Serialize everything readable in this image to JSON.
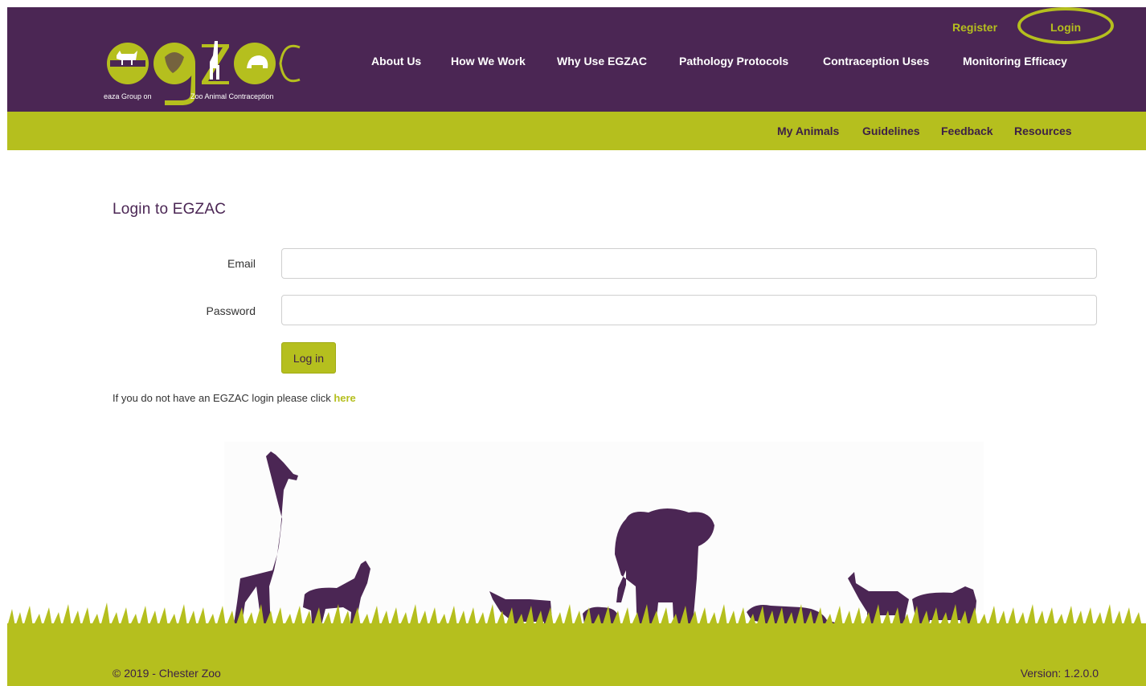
{
  "brand": {
    "logo_text": "egzac",
    "logo_subtext": "eaza Group on Zoo Animal Contraception",
    "colors": {
      "purple": "#4b2654",
      "lime": "#b5bf1e"
    }
  },
  "util_nav": {
    "register": "Register",
    "login": "Login"
  },
  "main_nav": [
    "About Us",
    "How We Work",
    "Why Use EGZAC",
    "Pathology Protocols",
    "Contraception Uses",
    "Monitoring Efficacy"
  ],
  "sub_nav": [
    "My Animals",
    "Guidelines",
    "Feedback",
    "Resources"
  ],
  "login": {
    "heading": "Login to EGZAC",
    "email_label": "Email",
    "email_value": "",
    "password_label": "Password",
    "password_value": "",
    "submit": "Log in",
    "hint_text": "If you do not have an EGZAC login please click ",
    "hint_link": "here"
  },
  "footer": {
    "copyright": "© 2019 - Chester Zoo",
    "version": "Version: 1.2.0.0"
  }
}
